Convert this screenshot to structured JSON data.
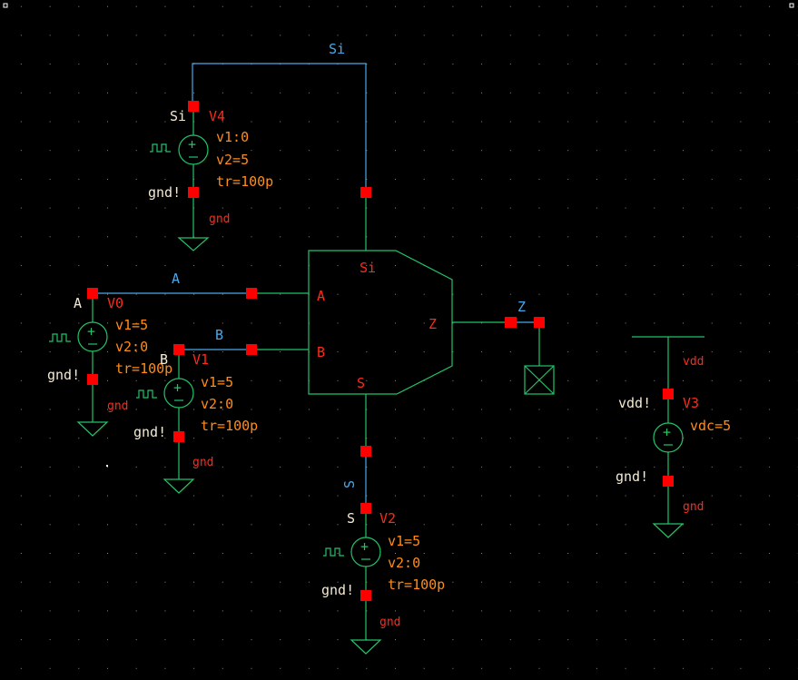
{
  "colors": {
    "background": "#000000",
    "wire": "#22c468",
    "net_wire": "#4aa8e8",
    "pin": "#ff0000",
    "param_text": "#ff8c1a",
    "inst_text": "#ff2a1a",
    "net_text": "#f4ead4"
  },
  "nets": {
    "si": "Si",
    "a": "A",
    "b": "B",
    "z": "Z",
    "s": "S"
  },
  "gate": {
    "pins": {
      "si": "Si",
      "a": "A",
      "b": "B",
      "z": "Z",
      "s": "S"
    }
  },
  "sources": {
    "v4": {
      "name": "V4",
      "net": "Si",
      "p1": "v1:0",
      "p2": "v2=5",
      "p3": "tr=100p",
      "gnd_net": "gnd!",
      "gnd": "gnd"
    },
    "v0": {
      "name": "V0",
      "net": "A",
      "p1": "v1=5",
      "p2": "v2:0",
      "p3": "tr=100p",
      "gnd_net": "gnd!",
      "gnd": "gnd"
    },
    "v1": {
      "name": "V1",
      "net": "B",
      "p1": "v1=5",
      "p2": "v2:0",
      "p3": "tr=100p",
      "gnd_net": "gnd!",
      "gnd": "gnd"
    },
    "v2": {
      "name": "V2",
      "net": "S",
      "p1": "v1=5",
      "p2": "v2:0",
      "p3": "tr=100p",
      "gnd_net": "gnd!",
      "gnd": "gnd"
    },
    "v3": {
      "name": "V3",
      "net": "vdd!",
      "p1": "vdc=5",
      "supply": "vdd",
      "gnd_net": "gnd!",
      "gnd": "gnd"
    }
  }
}
